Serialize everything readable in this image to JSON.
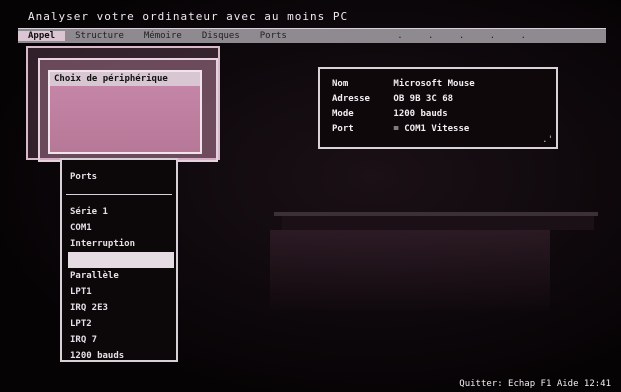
{
  "window": {
    "title": "Analyser votre ordinateur avec au moins PC"
  },
  "menubar": {
    "items": [
      {
        "label": "Appel"
      },
      {
        "label": "Structure"
      },
      {
        "label": "Mémoire"
      },
      {
        "label": "Disques"
      },
      {
        "label": "Ports"
      }
    ]
  },
  "dialog": {
    "title": "Choix de périphérique"
  },
  "info": {
    "rows": [
      {
        "key": "Nom",
        "value": "Microsoft Mouse"
      },
      {
        "key": "Adresse",
        "value": "OB 9B 3C 68"
      },
      {
        "key": "Mode",
        "value": "1200 bauds"
      },
      {
        "key": "Port",
        "value": "= COM1 Vitesse"
      }
    ]
  },
  "panel": {
    "title": "Ports",
    "items": [
      {
        "label": "Série 1"
      },
      {
        "label": "COM1"
      },
      {
        "label": "Interruption"
      },
      {
        "label": ""
      },
      {
        "label": "Parallèle"
      },
      {
        "label": "LPT1"
      },
      {
        "label": "IRQ 2E3"
      },
      {
        "label": "LPT2"
      },
      {
        "label": "IRQ 7"
      },
      {
        "label": "1200 bauds"
      }
    ]
  },
  "status": {
    "text": "Quitter: Echap   F1 Aide 12:41"
  }
}
